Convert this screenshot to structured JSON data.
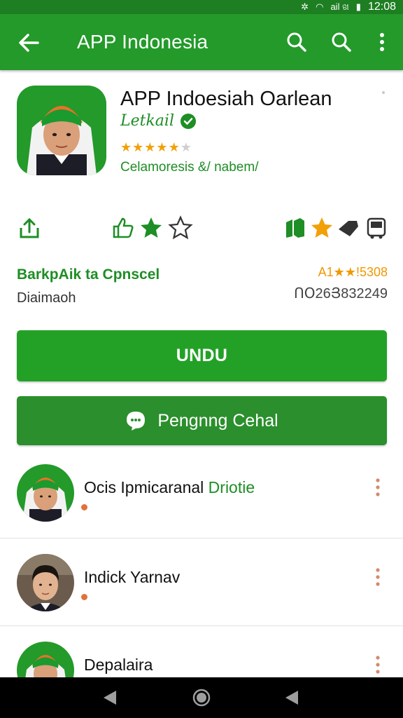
{
  "status_bar": {
    "time": "12:08",
    "icons": [
      "bluetooth-icon",
      "wifi-icon",
      "signal-icon",
      "battery-icon"
    ],
    "network_label": "ail ଖ"
  },
  "app_bar": {
    "title": "APP Indonesia",
    "background": "#239a2a"
  },
  "app": {
    "name": "APP Indoesiah Oarlean",
    "developer": "Letkail",
    "rating_stars": 4.5,
    "category": "Celamoresis &/ nabem/"
  },
  "info": {
    "left_title": "BarkpAik ta Cpnscel",
    "left_sub": "Diaimaoh",
    "right_rating": "A1★★!5308",
    "right_count": "ՈՕ26Յ832249"
  },
  "buttons": {
    "install": "UNDU",
    "secondary": "Pengnng Cehal"
  },
  "list": [
    {
      "name_prefix": "Ocis Ipmicaranal ",
      "name_highlight": "Driotie"
    },
    {
      "name_prefix": "Indick Yarnav",
      "name_highlight": ""
    },
    {
      "name_prefix": "Depalaira",
      "name_highlight": ""
    }
  ],
  "colors": {
    "primary": "#239a2a",
    "accent_text": "#1e8e25",
    "star": "#f2a007",
    "dot": "#e0733c"
  }
}
